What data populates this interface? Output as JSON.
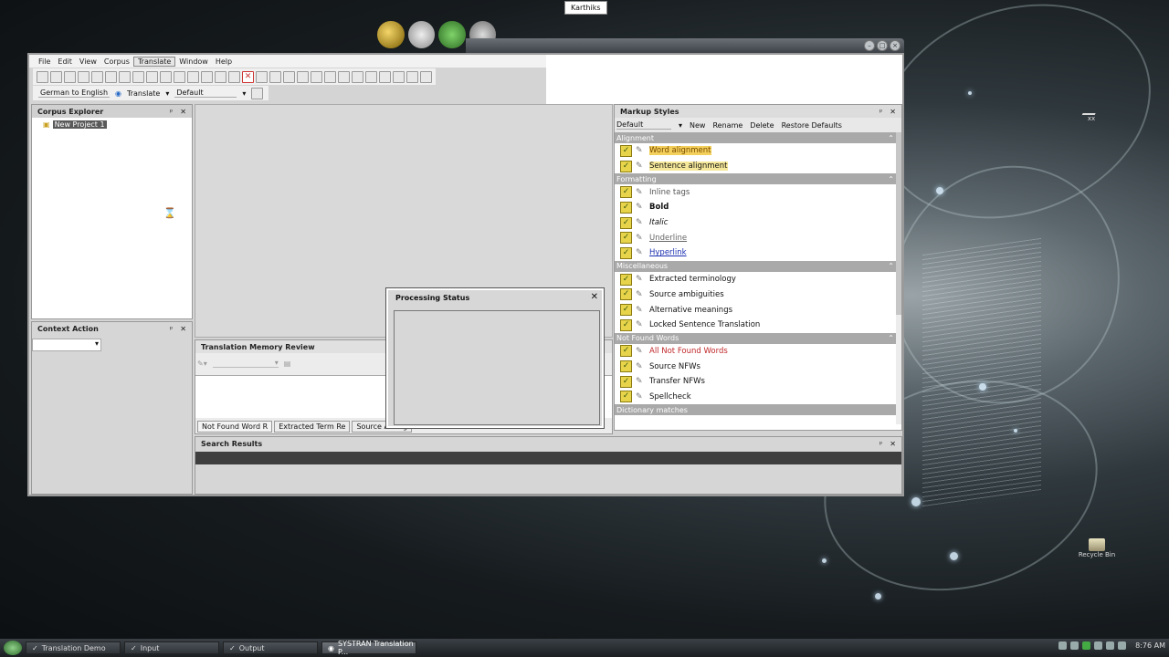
{
  "tooltip": "Karthiks",
  "menu": [
    "File",
    "Edit",
    "View",
    "Corpus",
    "Translate",
    "Window",
    "Help"
  ],
  "menu_active": "Translate",
  "toolbar2": {
    "language_pair": "German to English",
    "translate_label": "Translate",
    "profile": "Default"
  },
  "corpus_explorer": {
    "title": "Corpus Explorer",
    "project": "New Project 1"
  },
  "context_action": {
    "title": "Context Action"
  },
  "tm_review": {
    "title": "Translation Memory Review",
    "tabs": [
      "Not Found Word R",
      "Extracted Term Re",
      "Source Ambig"
    ]
  },
  "search_results": {
    "title": "Search Results"
  },
  "processing": {
    "title": "Processing Status"
  },
  "markup": {
    "title": "Markup Styles",
    "preset": "Default",
    "actions": [
      "New",
      "Rename",
      "Delete",
      "Restore Defaults"
    ],
    "sections": [
      {
        "name": "Alignment",
        "items": [
          "Word alignment",
          "Sentence alignment"
        ]
      },
      {
        "name": "Formatting",
        "items": [
          "Inline tags",
          "Bold",
          "Italic",
          "Underline",
          "Hyperlink"
        ]
      },
      {
        "name": "Miscellaneous",
        "items": [
          "Extracted terminology",
          "Source ambiguities",
          "Alternative meanings",
          "Locked Sentence Translation"
        ]
      },
      {
        "name": "Not Found Words",
        "items": [
          "All Not Found Words",
          "Source NFWs",
          "Transfer NFWs",
          "Spellcheck"
        ]
      }
    ],
    "next_section_partial": "Dictionary matches"
  },
  "taskbar": {
    "tasks": [
      "Translation Demo",
      "Input",
      "Output",
      "SYSTRAN Translation P..."
    ],
    "active_task": "SYSTRAN Translation P...",
    "clock": "8:76 AM"
  },
  "desktop": {
    "recycle_bin": "Recycle Bin",
    "top_icon": "xx"
  }
}
